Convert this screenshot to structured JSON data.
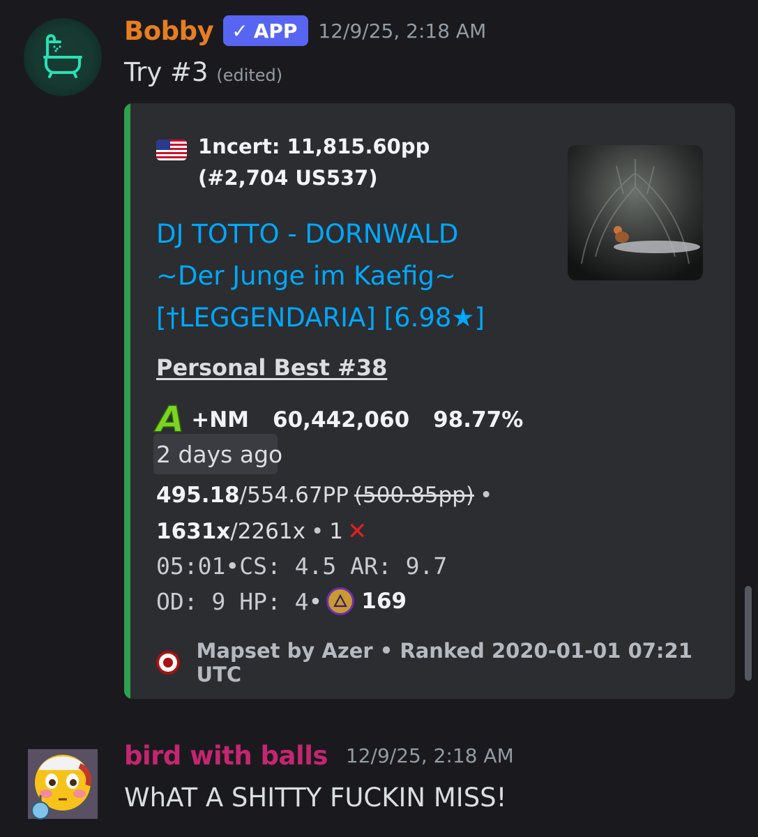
{
  "messages": [
    {
      "author": "Bobby",
      "author_color": "#e67e22",
      "badge": "APP",
      "timestamp": "12/9/25, 2:18 AM",
      "text": "Try #3",
      "edited_label": "(edited)",
      "avatar_icon": "bathtub-icon",
      "embed": {
        "accent_color": "#2e9f4f",
        "author_flag": "us-flag-icon",
        "author_text": "1ncert: 11,815.60pp (#2,704 US537)",
        "title_lines": [
          "DJ TOTTO - DORNWALD",
          "~Der Junge im Kaefig~",
          "[†LEGGENDARIA] [6.98★]"
        ],
        "field_name": "Personal Best #38",
        "grade": "A",
        "mods": "+NM",
        "score": "60,442,060",
        "accuracy": "98.77%",
        "relative_time": "2 days ago",
        "pp": "495.18",
        "pp_max": "/554.67PP",
        "pp_old": "(500.85pp)",
        "sep": "•",
        "combo": "1631x",
        "combo_max": "/2261x",
        "misses": "1",
        "miss_icon": "red-x-icon",
        "stats_line1": "05:01•CS: 4.5 AR: 9.7",
        "stats_line2": "OD: 9 HP: 4•",
        "medal_icon": "medal-icon",
        "medal_count": "169",
        "footer_icon": "osu-logo-icon",
        "footer_text": "Mapset by Azer • Ranked 2020-01-01 07:21 UTC",
        "thumbnail": "map-background-thumbnail"
      }
    },
    {
      "author": "bird with balls",
      "author_color": "#c4266f",
      "timestamp": "12/9/25, 2:18 AM",
      "text": "WhAT A SHITTY FUCKIN MISS!",
      "avatar_icon": "flushed-emoji-avatar"
    }
  ]
}
